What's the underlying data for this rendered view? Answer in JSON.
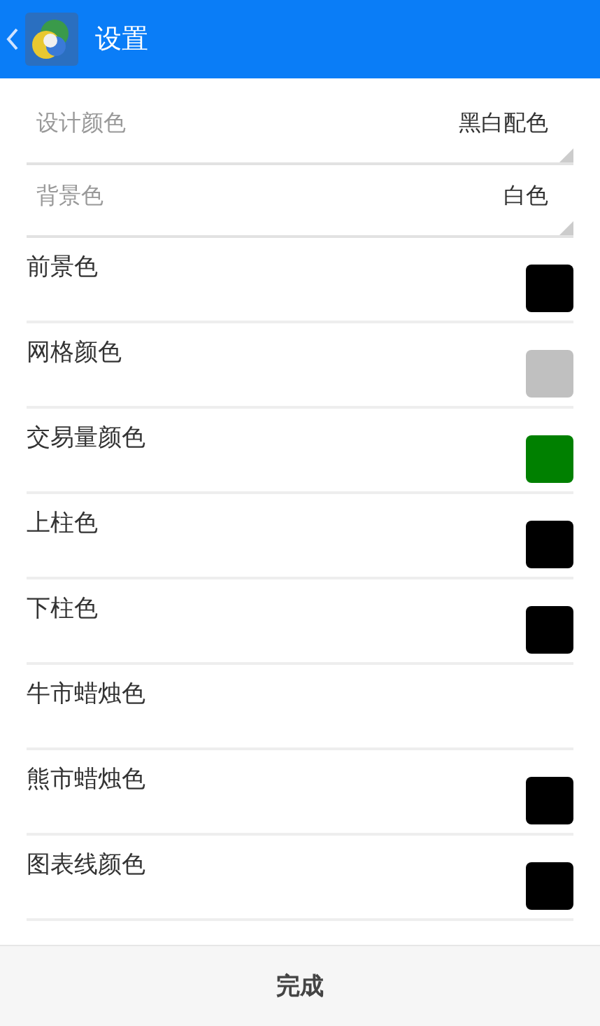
{
  "header": {
    "title": "设置"
  },
  "selects": [
    {
      "label": "设计颜色",
      "value": "黑白配色"
    },
    {
      "label": "背景色",
      "value": "白色"
    }
  ],
  "colors": [
    {
      "label": "前景色",
      "color": "#000000"
    },
    {
      "label": "网格颜色",
      "color": "#c0c0c0"
    },
    {
      "label": "交易量颜色",
      "color": "#008000"
    },
    {
      "label": "上柱色",
      "color": "#000000"
    },
    {
      "label": "下柱色",
      "color": "#000000"
    },
    {
      "label": "牛市蜡烛色"
    },
    {
      "label": "熊市蜡烛色",
      "color": "#000000"
    },
    {
      "label": "图表线颜色",
      "color": "#000000"
    }
  ],
  "footer": {
    "button": "完成"
  }
}
